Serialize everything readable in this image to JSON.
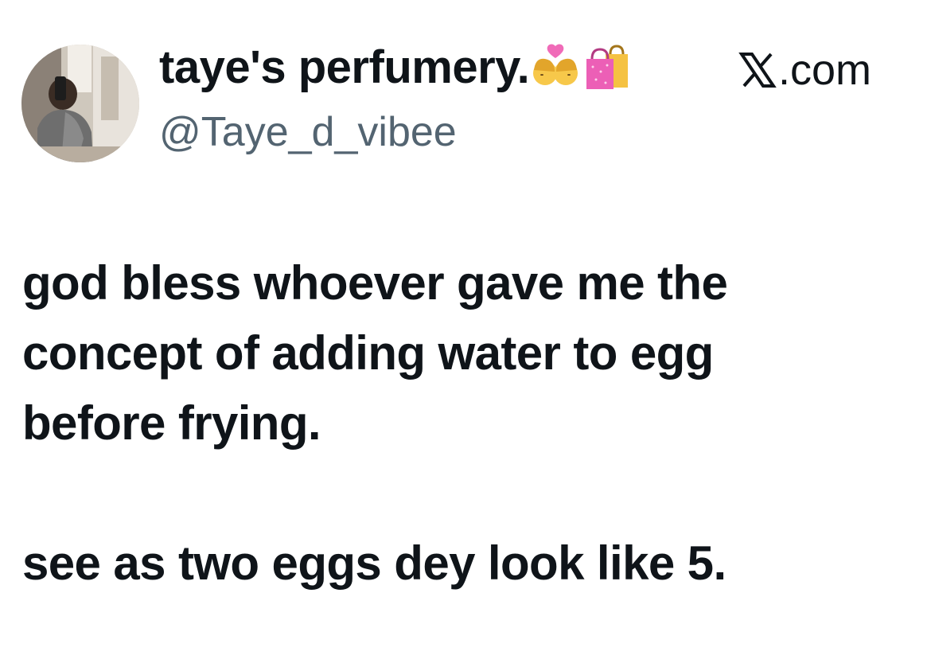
{
  "author": {
    "display_name": "taye's perfumery.",
    "emojis": [
      "couple-with-heart-women-emoji",
      "shopping-bags-emoji"
    ],
    "handle": "@Taye_d_vibee",
    "avatar_alt": "profile photo"
  },
  "source": {
    "label": ".com",
    "icon": "x-logo-icon"
  },
  "tweet": {
    "paragraph_1_line_1": "god bless whoever gave me the",
    "paragraph_1_line_2": "concept of adding water to egg",
    "paragraph_1_line_3": "before frying.",
    "paragraph_2": "see as two eggs dey look like 5."
  },
  "colors": {
    "text": "#0f1419",
    "secondary_text": "#536471",
    "background": "#ffffff"
  }
}
